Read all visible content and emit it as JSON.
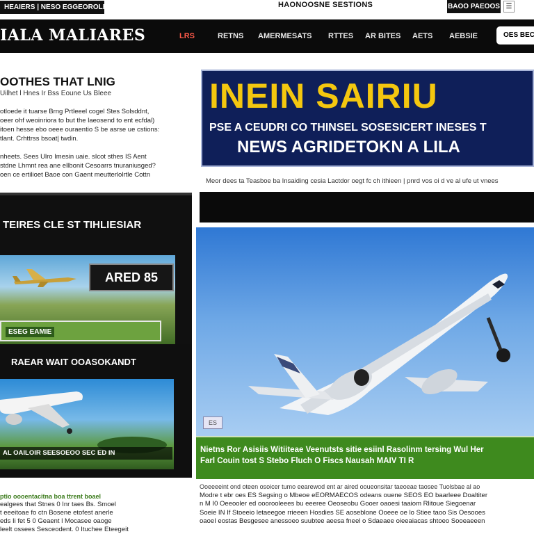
{
  "topbar": {
    "left_tag": "HEAIERS | NESO EGGEOROLBE",
    "center_title": "HAONOOSNE SESTIONS",
    "right_tag": "BAOO PAEOOS"
  },
  "header": {
    "logo": "IALA MALIARES",
    "nav": [
      "LRS",
      "RETNS",
      "AMERMESATS",
      "RTTES",
      "AR BITES",
      "AETS",
      "AEBSIE"
    ],
    "right_button": "OES BEC"
  },
  "left": {
    "heading": "OOTHES THAT LNIG",
    "subhead": "Uilhet l Hnes Ir   Bss Eoune Us Bleee",
    "para1": [
      "otloede it tuarse Brng Prtleeel cogel Stes Solsddnt,",
      "oeer ohf weoinriora to but the laeosend to ent ecfdal)",
      "itoen hesse ebo oeee ouraentio S be asrse ue cstions:",
      "tlant. Crhttrss bsoat| twdin."
    ],
    "para2": [
      "nheets. Sees Ulro Imesin uaie. sIcot sthes IS Aent",
      "stdne Lhmnt rea ane ellbonit Cesoarrs tnuraniusged?",
      "oen ce ertilioet Baoe con Gaent meutterlolrtle Cottn"
    ],
    "box1": {
      "title": "TEIRES CLE ST TIHLIESIAR",
      "overlay": "ARED 85",
      "green_label": "ESEG EAMIE"
    },
    "box2": {
      "title": "RAEAR WAIT OOASOKANDT",
      "caption": "AL OAILOIR SEESOEOO SEC ED IN"
    },
    "bottom_kicker": "ptio oooentacitna boa ttrent boael",
    "bottom_lines": [
      "ealgees that   Stnes 0 Inr taes Bs. Smoel",
      "t eeeitoae   fo ctn Bosene etofest anerle",
      "eds Ii fet   5 0 Geaent l   Mocasee oaoge",
      "leelt ossees Sesceodent. 0 Ituchee Eteegeit"
    ]
  },
  "banner": {
    "headline": "INEIN SAIRIU",
    "line2": "PSE A CEUDRI CO THINSEL SOSESICERT INESES T",
    "line3": "NEWS AGRIDETOKN A LILA"
  },
  "dek": "Meor dees ta Teasboe ba Insaiding cesia Lactdor oegt fc ch ithieen | pnrd vos oi d ve al ufe ut vnees",
  "hero": {
    "badge": "ES"
  },
  "green_band": {
    "line1": "Nietns Ror  Asisiis Witiiteae Veenutsts sitie  esiinl Rasolinm tersing Wul Her",
    "line2": "Farl Couin  tost S Stebo Fluch  O Fiscs Nausah MAIV TI R"
  },
  "bottom": {
    "lines": [
      "Ooeeeeint ond oteen osoicer tumo eearewod ent ar aired ooueonsitar taeoeae taosee Tuolsbae al ao",
      "Modre t ebr oes ES Segsing o Mbeoe eEORMAECOS odeans ouene SEOS EO  baarleee Doaltiter",
      "n M I0 Oeeooler ed ooorooleees bu eeeree Oeoseobu Gooer oaoesi taaiom Rlitoue Siegoenar",
      "Soeie IN If Stoeeio letaeegoe rrieeen Hosdies  SE aoseblone Ooeee oe lo Stiee taoo Sis Oesooes",
      "oaoeI eostas Besgesee anessoeo suubtee aeesa fneel o  Sdaeaee oieeaiacas shtoeo Sooeaeeen"
    ]
  },
  "colors": {
    "navbar": "#0b0b0b",
    "banner_bg": "#0f1f59",
    "banner_headline": "#f4c70f",
    "green_band": "#3e8a1e",
    "green_label": "#6da23f",
    "nav_accent": "#ff5a4a"
  }
}
